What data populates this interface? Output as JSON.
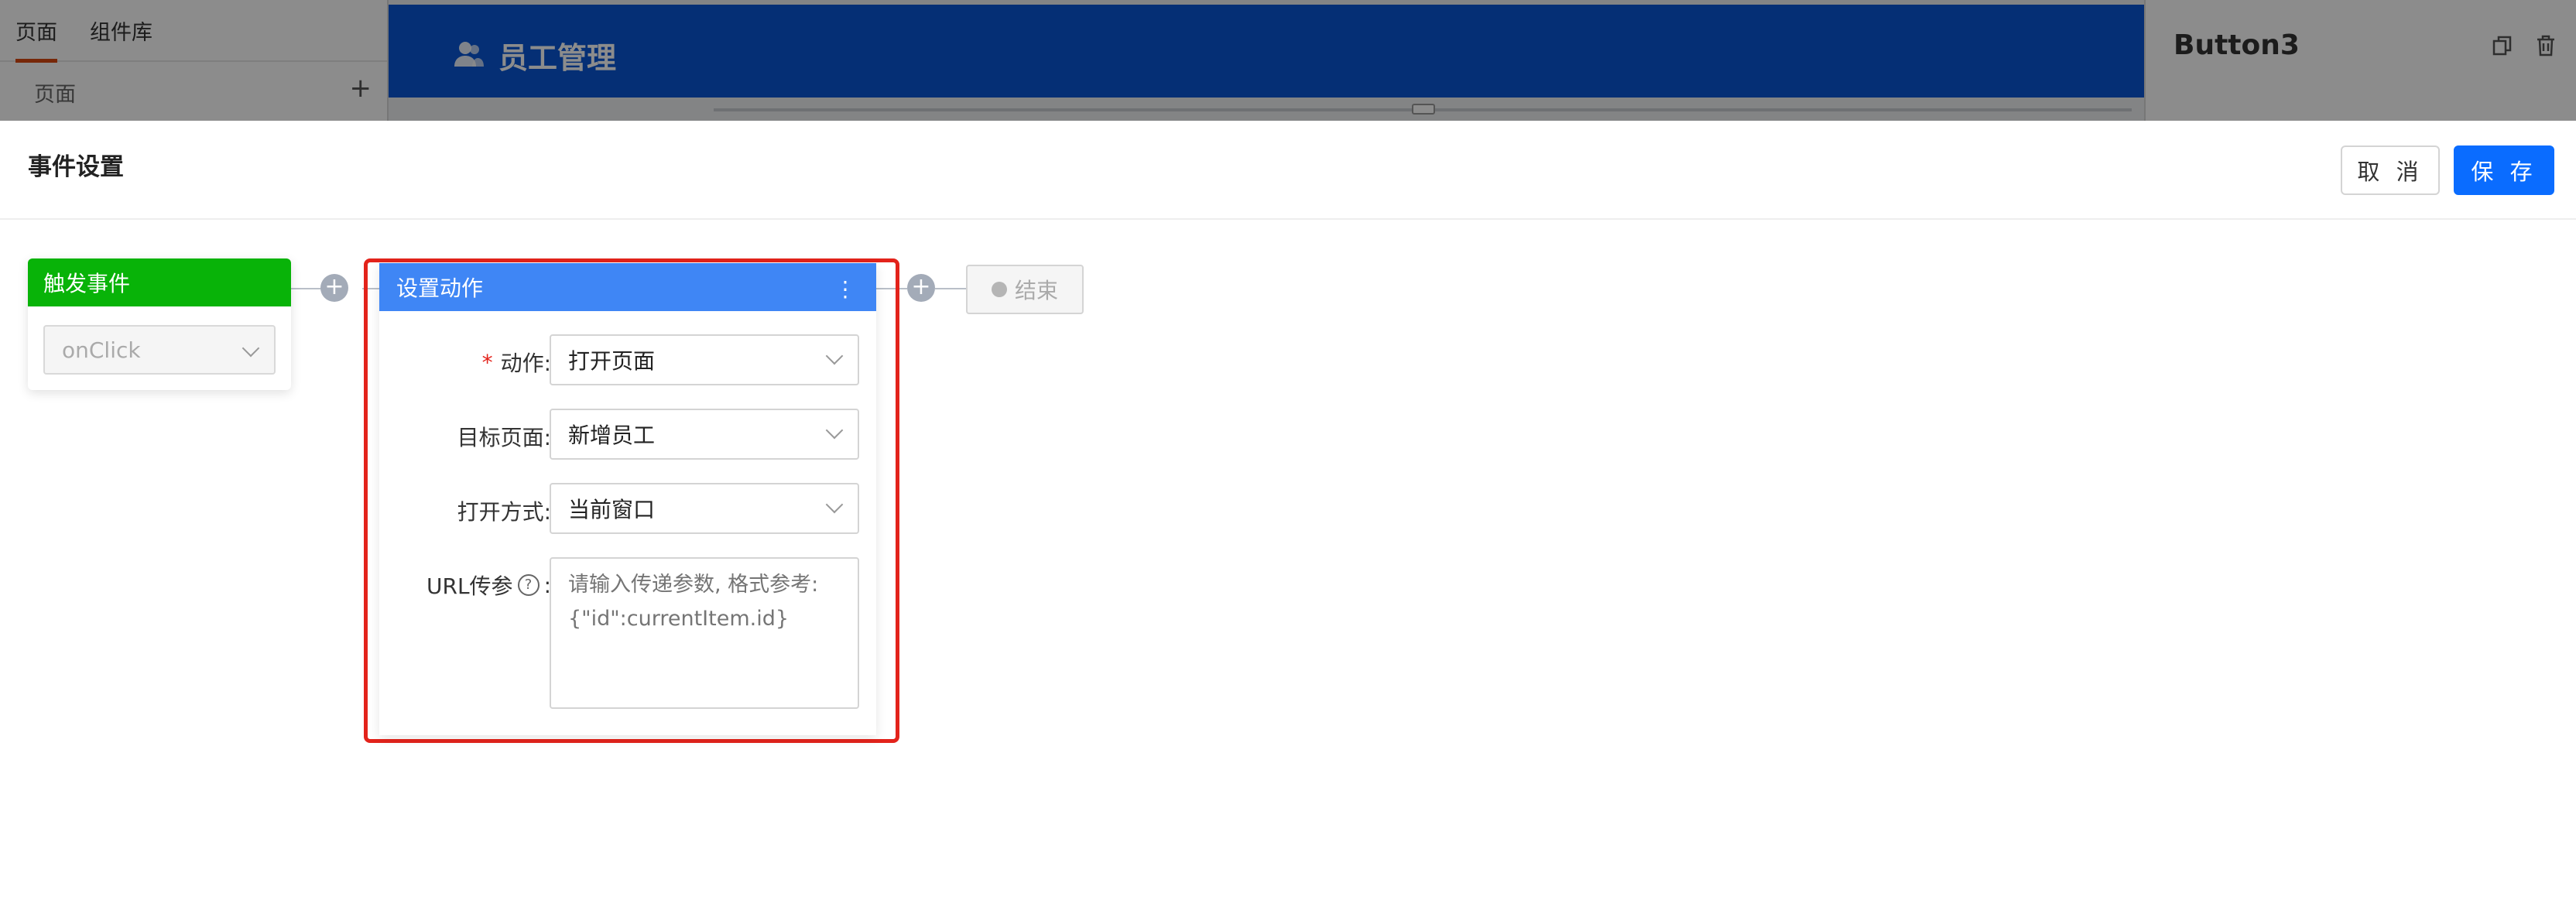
{
  "background": {
    "left_panel": {
      "tabs": [
        "页面",
        "组件库"
      ],
      "section_label": "页面",
      "add_symbol": "+"
    },
    "canvas": {
      "app_title": "员工管理",
      "header_color": "#0a57d6"
    },
    "right_panel": {
      "title": "Button3",
      "icons": [
        "copy-icon",
        "trash-icon"
      ]
    }
  },
  "dialog": {
    "title": "事件设置",
    "cancel_label": "取 消",
    "save_label": "保 存",
    "accent_color": "#0a6cff"
  },
  "flow": {
    "trigger": {
      "title": "触发事件",
      "event_value": "onClick",
      "header_color": "#08b308"
    },
    "action": {
      "title": "设置动作",
      "header_color": "#3f86f5",
      "fields": {
        "action": {
          "label": "动作:",
          "value": "打开页面",
          "required": true
        },
        "target_page": {
          "label": "目标页面:",
          "value": "新增员工"
        },
        "open_mode": {
          "label": "打开方式:",
          "value": "当前窗口"
        },
        "url_params": {
          "label_prefix": "URL传参",
          "label_suffix": ":",
          "placeholder": "请输入传递参数, 格式参考: {\"id\":currentItem.id}"
        }
      },
      "highlight_color": "#e3231b"
    },
    "end": {
      "label": "结束"
    },
    "add_symbol": "+"
  }
}
